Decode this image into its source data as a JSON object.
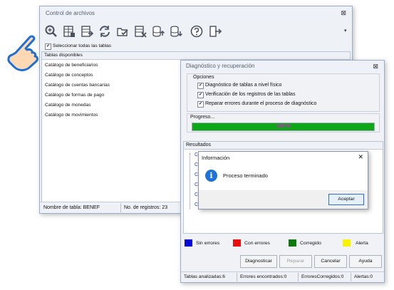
{
  "main_window": {
    "title": "Control de archivos",
    "close_glyph": "⊠",
    "toolbar_icons": [
      "zoom-icon",
      "table-grid-icon",
      "table-export-icon",
      "refresh-icon",
      "folder-check-icon",
      "table-delete-icon",
      "database-up-icon",
      "database-down-icon",
      "help-icon",
      "exit-icon"
    ],
    "select_all_label": "Seleccionar todas las tablas",
    "tables_header": "Tablas disponibles",
    "tables": [
      "Catálogo de beneficiarios",
      "Catálogo de conceptos",
      "Catálogo de cuentas bancarias",
      "Catálogo de formas de pago",
      "Catálogo de monedas",
      "Catálogo de movimientos"
    ],
    "status_table_name": "Nombre de tabla: BENEF",
    "status_record_count": "No. de registros: 23"
  },
  "diag_window": {
    "title": "Diagnóstico y recuperación",
    "close_glyph": "⊠",
    "options_label": "Opciones",
    "options": [
      {
        "label": "Diagnóstico de  tablas a nivel físico",
        "checked": true
      },
      {
        "label": "Verificación de los registros de las tablas",
        "checked": true
      },
      {
        "label": "Reparar errores durante el proceso de diagnóstico",
        "checked": true
      }
    ],
    "progress_label": "Progreso...",
    "progress_text": "100 %",
    "progress_value": 1.0,
    "progress_color": "#0ca818",
    "results_label": "Resultados",
    "legend": [
      {
        "label": "Sin errores",
        "color": "#0a0ad8"
      },
      {
        "label": "Con errores",
        "color": "#e80e0e"
      },
      {
        "label": "Corregido",
        "color": "#0c7a0c"
      },
      {
        "label": "Alerta",
        "color": "#f6f200"
      }
    ],
    "buttons": {
      "diagnose": "Diagnosticar",
      "repair": "Reparar",
      "cancel": "Cancelar",
      "help": "Ayuda"
    },
    "status": {
      "analyzed": "Tablas analizadas:6",
      "errors_found": "Errores encontrados:0",
      "errors_fixed": "ErroresCorregidos:0",
      "alerts": "Alertas:0"
    }
  },
  "info_dialog": {
    "title": "Información",
    "close_glyph": "✕",
    "message": "Proceso terminado",
    "accept_label": "Aceptar"
  }
}
